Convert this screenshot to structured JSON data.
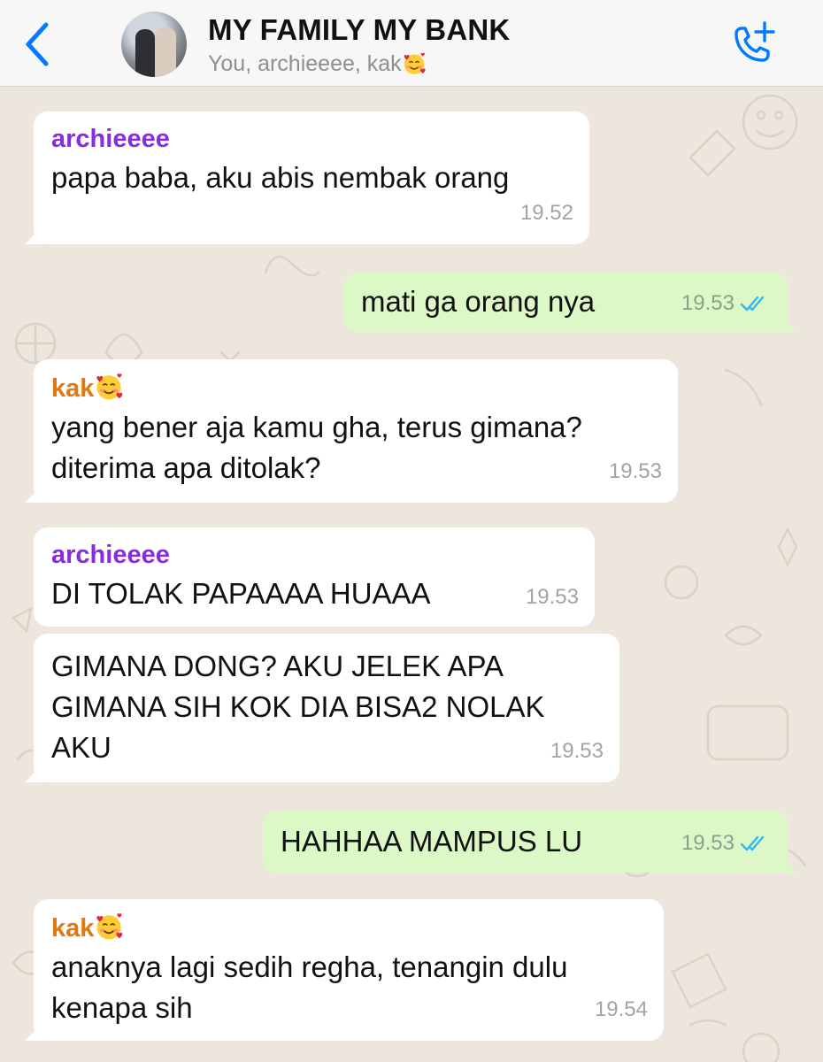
{
  "header": {
    "title": "MY FAMILY MY BANK",
    "subtitle": "You, archieeee, kak",
    "back_icon": "chevron-left-icon",
    "call_icon": "add-call-icon",
    "accent_color": "#007aff"
  },
  "messages": [
    {
      "direction": "incoming",
      "sender": "archieeee",
      "text": [
        "papa baba, aku abis nembak orang"
      ],
      "time": "19.52"
    },
    {
      "direction": "outgoing",
      "text": [
        "mati ga orang nya"
      ],
      "time": "19.53",
      "status": "read"
    },
    {
      "direction": "incoming",
      "sender": "kak",
      "text": [
        "yang bener aja kamu gha, terus gimana?",
        "diterima apa ditolak?"
      ],
      "time": "19.53"
    },
    {
      "direction": "incoming",
      "sender": "archieeee",
      "text": [
        "DI TOLAK PAPAAAA HUAAA"
      ],
      "time": "19.53"
    },
    {
      "direction": "incoming",
      "text": [
        "GIMANA DONG? AKU JELEK APA",
        "GIMANA SIH KOK DIA BISA2 NOLAK",
        "AKU"
      ],
      "time": "19.53"
    },
    {
      "direction": "outgoing",
      "text": [
        "HAHHAA MAMPUS LU"
      ],
      "time": "19.53",
      "status": "read"
    },
    {
      "direction": "incoming",
      "sender": "kak",
      "text": [
        "anaknya lagi sedih regha, tenangin dulu",
        "kenapa sih"
      ],
      "time": "19.54"
    }
  ],
  "colors": {
    "incoming_bubble": "#ffffff",
    "outgoing_bubble": "#dcf8c6",
    "sender_archieeee": "#8a2be2",
    "sender_kak": "#e4770e",
    "read_ticks": "#34b7f1"
  }
}
